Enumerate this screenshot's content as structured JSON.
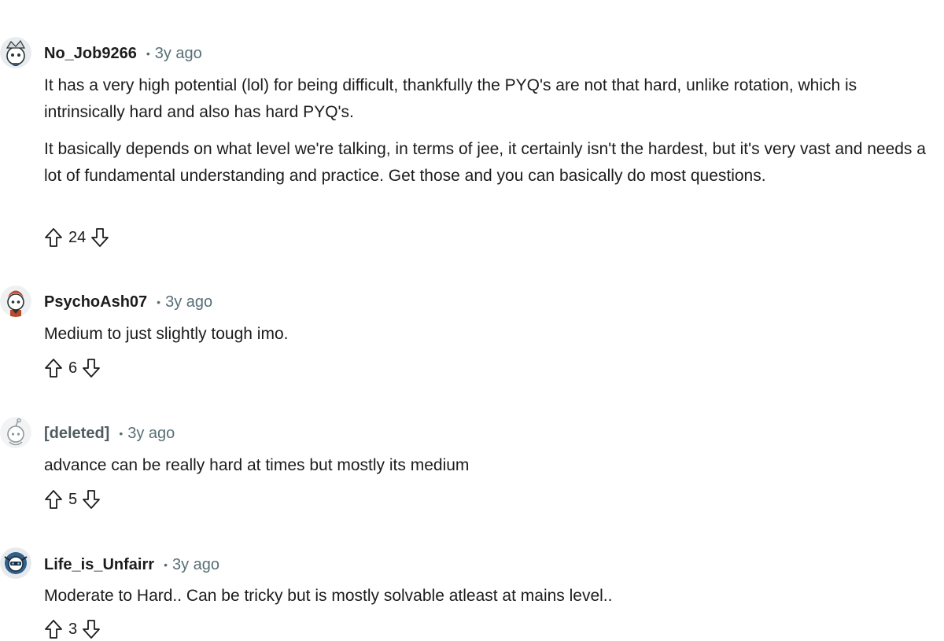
{
  "comments": [
    {
      "username": "No_Job9266",
      "time": "3y ago",
      "paragraphs": [
        "It has a very high potential (lol) for being difficult, thankfully the PYQ's are not that hard, unlike rotation, which is intrinsically hard and also has hard PYQ's.",
        "It basically depends on what level we're talking, in terms of jee, it certainly isn't the hardest, but it's very vast and needs a lot of fundamental understanding and practice. Get those and you can basically do most questions."
      ],
      "score": "24",
      "avatar_icon": "snoo-avatar-icon"
    },
    {
      "username": "PsychoAsh07",
      "time": "3y ago",
      "paragraphs": [
        "Medium to just slightly tough imo."
      ],
      "score": "6",
      "avatar_icon": "snoo-avatar-icon"
    },
    {
      "username": "[deleted]",
      "time": "3y ago",
      "paragraphs": [
        "advance can be really hard at times but mostly its medium"
      ],
      "score": "5",
      "avatar_icon": "deleted-avatar-icon"
    },
    {
      "username": "Life_is_Unfairr",
      "time": "3y ago",
      "paragraphs": [
        "Moderate to Hard.. Can be tricky but is mostly solvable atleast at mains level.."
      ],
      "score": "3",
      "avatar_icon": "snoo-avatar-icon"
    }
  ],
  "separator": "•",
  "icons": {
    "upvote": "upvote-arrow-icon",
    "downvote": "downvote-arrow-icon"
  },
  "colors": {
    "text": "#1c1c1c",
    "meta": "#576f76"
  }
}
